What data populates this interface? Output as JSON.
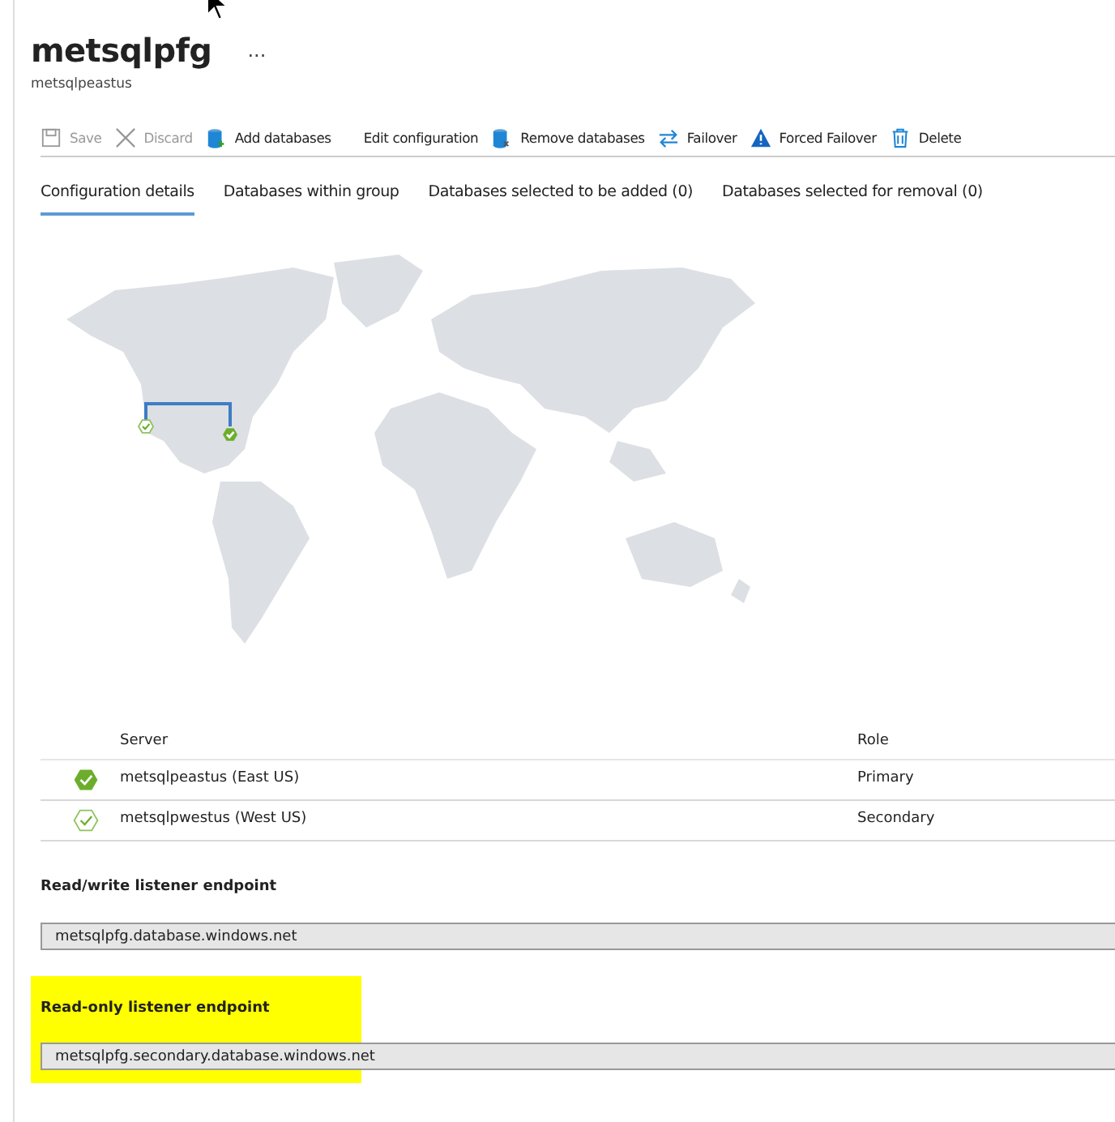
{
  "header": {
    "title": "metsqlpfg",
    "more": "...",
    "subtitle": "metsqlpeastus"
  },
  "toolbar": [
    {
      "label": "Save",
      "kind": "save",
      "disabled": true
    },
    {
      "label": "Discard",
      "kind": "discard",
      "disabled": true
    },
    {
      "label": "Add databases",
      "kind": "add",
      "disabled": false
    },
    {
      "label": "Edit configuration",
      "kind": "edit",
      "disabled": false
    },
    {
      "label": "Remove databases",
      "kind": "remove",
      "disabled": false
    },
    {
      "label": "Failover",
      "kind": "failover",
      "disabled": false
    },
    {
      "label": "Forced Failover",
      "kind": "forced",
      "disabled": false
    },
    {
      "label": "Delete",
      "kind": "delete",
      "disabled": false
    }
  ],
  "tabs": [
    {
      "label": "Configuration details",
      "selected": true
    },
    {
      "label": "Databases within group",
      "selected": false
    },
    {
      "label": "Databases selected to be added (0)",
      "selected": false
    },
    {
      "label": "Databases selected for removal (0)",
      "selected": false
    }
  ],
  "servers": {
    "columns": [
      "Server",
      "Role"
    ],
    "rows": [
      {
        "server": "metsqlpeastus (East US)",
        "role": "Primary",
        "filled": true
      },
      {
        "server": "metsqlpwestus (West US)",
        "role": "Secondary",
        "filled": false
      }
    ]
  },
  "endpoints": [
    {
      "label": "Read/write listener endpoint",
      "value": "metsqlpfg.database.windows.net",
      "highlighted": false
    },
    {
      "label": "Read-only listener endpoint",
      "value": "metsqlpfg.secondary.database.windows.net",
      "highlighted": true
    }
  ]
}
